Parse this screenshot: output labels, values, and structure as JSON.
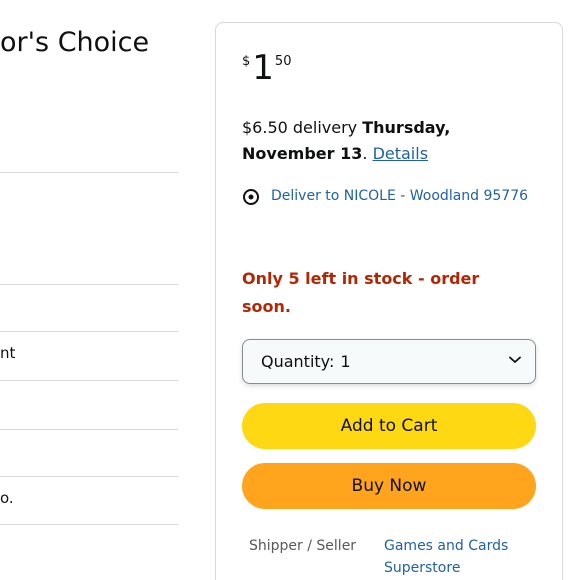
{
  "left": {
    "heading": "or's Choice",
    "rows": [
      "nt",
      "o."
    ]
  },
  "buybox": {
    "price": {
      "symbol": "$",
      "whole": "1",
      "fraction": "50"
    },
    "delivery": {
      "prefix": "$6.50 delivery",
      "date": "Thursday, November 13",
      "suffix": ".",
      "details_link": "Details"
    },
    "deliver_to": {
      "icon": "location-pin-icon",
      "text": "Deliver to NICOLE - Woodland 95776"
    },
    "stock_warning": "Only 5 left in stock - order soon.",
    "quantity": {
      "label": "Quantity:",
      "value": "1"
    },
    "add_to_cart_label": "Add to Cart",
    "buy_now_label": "Buy Now",
    "seller": {
      "label": "Shipper / Seller",
      "value": "Games and Cards Superstore"
    }
  },
  "colors": {
    "add_to_cart": "#ffd814",
    "buy_now": "#ffa41c",
    "link": "#2162a1",
    "stock_warning": "#b12704",
    "divider": "#d5d9d9"
  }
}
